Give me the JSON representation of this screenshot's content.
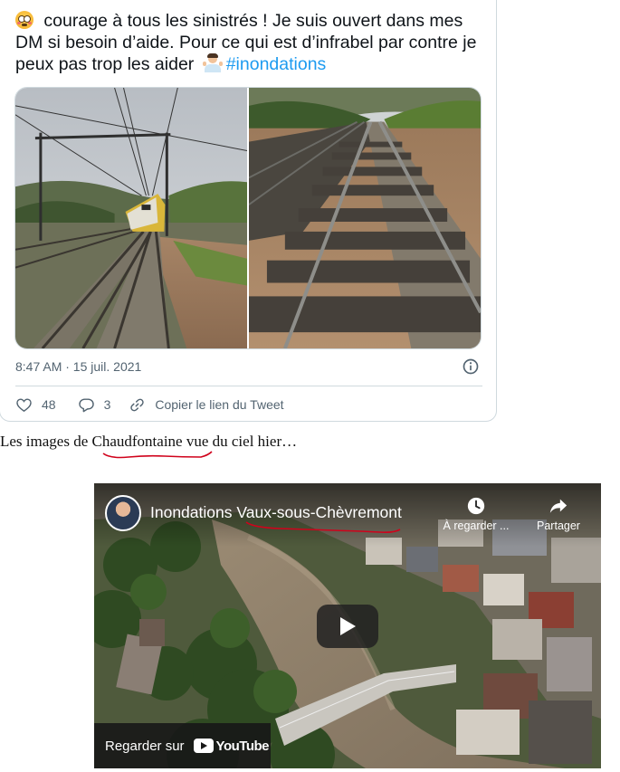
{
  "tweet": {
    "text_main": " courage à tous les sinistrés ! Je suis ouvert dans mes DM si besoin d’aide. Pour ce qui est d’infrabel par contre je peux pas trop les aider ",
    "hashtag": "#inondations",
    "timestamp": "8:47 AM · 15 juil. 2021",
    "like_count": "48",
    "reply_count": "3",
    "copy_link_label": "Copier le lien du Tweet",
    "emoji_1": "flushed-face-emoji",
    "emoji_2": "person-shrugging-emoji"
  },
  "caption": {
    "before": "Les images de ",
    "highlight": "Chaudfontaine",
    "after": " vue du ciel hier…",
    "annotation_color": "#d0021b"
  },
  "video": {
    "title": "Inondations Vaux-sous-Chèvremont",
    "watch_later_label": "À regarder ...",
    "share_label": "Partager",
    "watch_on_label": "Regarder sur",
    "brand": "YouTube"
  },
  "colors": {
    "link": "#1d9bf0",
    "meta_text": "#536471",
    "border": "#cfd9de",
    "annotation_red": "#d0021b"
  }
}
